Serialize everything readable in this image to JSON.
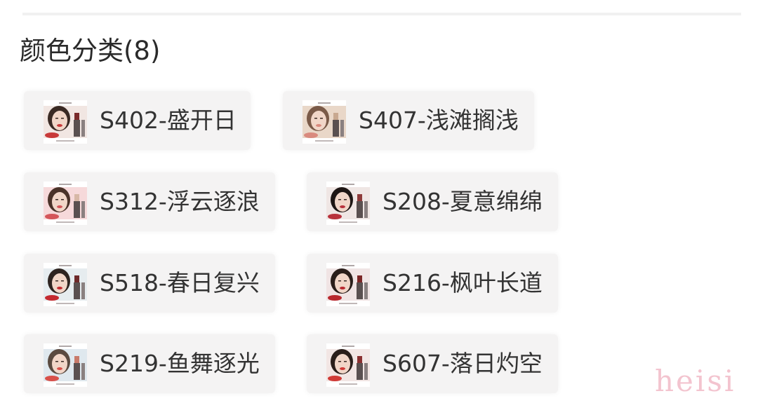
{
  "section": {
    "title": "颜色分类(8)"
  },
  "options": [
    {
      "label": "S402-盛开日",
      "selected": false,
      "thumb": {
        "bg": "#f1e6e2",
        "lip": "#c83a3a",
        "lipstick": "#7a2a2a",
        "hair": "#3a2a24"
      }
    },
    {
      "label": "S407-浅滩搁浅",
      "selected": false,
      "thumb": {
        "bg": "#e9d7c8",
        "lip": "#d98a7e",
        "lipstick": "#c8a890",
        "hair": "#7a5a48"
      }
    },
    {
      "label": "S312-浮云逐浪",
      "selected": false,
      "thumb": {
        "bg": "#f6d9da",
        "lip": "#d4565a",
        "lipstick": "#d7b8a6",
        "hair": "#4a3228"
      }
    },
    {
      "label": "S208-夏意绵绵",
      "selected": false,
      "thumb": {
        "bg": "#efe6e4",
        "lip": "#b8323c",
        "lipstick": "#8e3a3a",
        "hair": "#1e1614"
      }
    },
    {
      "label": "S518-春日复兴",
      "selected": false,
      "thumb": {
        "bg": "#e6ecef",
        "lip": "#c42a30",
        "lipstick": "#6e2a2a",
        "hair": "#2e2420"
      }
    },
    {
      "label": "S216-枫叶长道",
      "selected": false,
      "thumb": {
        "bg": "#f0e4e4",
        "lip": "#b8282e",
        "lipstick": "#7c2626",
        "hair": "#2a1e1a"
      }
    },
    {
      "label": "S219-鱼舞逐光",
      "selected": false,
      "thumb": {
        "bg": "#dfe8ee",
        "lip": "#d8504a",
        "lipstick": "#c87a6a",
        "hair": "#5a4a40"
      }
    },
    {
      "label": "S607-落日灼空",
      "selected": false,
      "thumb": {
        "bg": "#f2e6e4",
        "lip": "#d03a36",
        "lipstick": "#8a3030",
        "hair": "#2a1e1a"
      }
    }
  ],
  "watermark": "heisi"
}
